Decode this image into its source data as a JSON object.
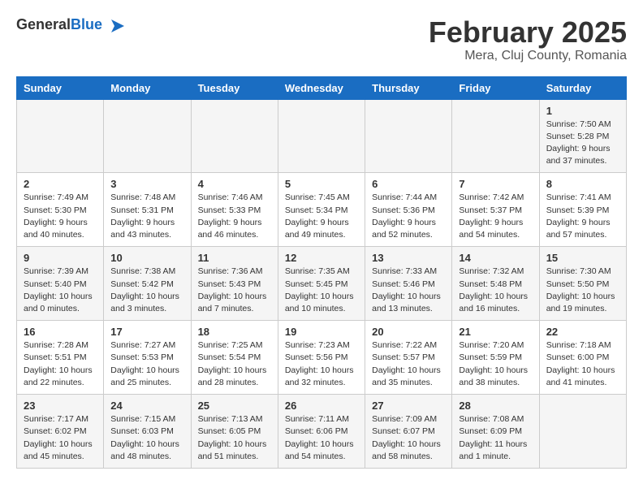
{
  "header": {
    "logo_general": "General",
    "logo_blue": "Blue",
    "month_title": "February 2025",
    "location": "Mera, Cluj County, Romania"
  },
  "weekdays": [
    "Sunday",
    "Monday",
    "Tuesday",
    "Wednesday",
    "Thursday",
    "Friday",
    "Saturday"
  ],
  "weeks": [
    [
      {
        "day": "",
        "info": ""
      },
      {
        "day": "",
        "info": ""
      },
      {
        "day": "",
        "info": ""
      },
      {
        "day": "",
        "info": ""
      },
      {
        "day": "",
        "info": ""
      },
      {
        "day": "",
        "info": ""
      },
      {
        "day": "1",
        "info": "Sunrise: 7:50 AM\nSunset: 5:28 PM\nDaylight: 9 hours and 37 minutes."
      }
    ],
    [
      {
        "day": "2",
        "info": "Sunrise: 7:49 AM\nSunset: 5:30 PM\nDaylight: 9 hours and 40 minutes."
      },
      {
        "day": "3",
        "info": "Sunrise: 7:48 AM\nSunset: 5:31 PM\nDaylight: 9 hours and 43 minutes."
      },
      {
        "day": "4",
        "info": "Sunrise: 7:46 AM\nSunset: 5:33 PM\nDaylight: 9 hours and 46 minutes."
      },
      {
        "day": "5",
        "info": "Sunrise: 7:45 AM\nSunset: 5:34 PM\nDaylight: 9 hours and 49 minutes."
      },
      {
        "day": "6",
        "info": "Sunrise: 7:44 AM\nSunset: 5:36 PM\nDaylight: 9 hours and 52 minutes."
      },
      {
        "day": "7",
        "info": "Sunrise: 7:42 AM\nSunset: 5:37 PM\nDaylight: 9 hours and 54 minutes."
      },
      {
        "day": "8",
        "info": "Sunrise: 7:41 AM\nSunset: 5:39 PM\nDaylight: 9 hours and 57 minutes."
      }
    ],
    [
      {
        "day": "9",
        "info": "Sunrise: 7:39 AM\nSunset: 5:40 PM\nDaylight: 10 hours and 0 minutes."
      },
      {
        "day": "10",
        "info": "Sunrise: 7:38 AM\nSunset: 5:42 PM\nDaylight: 10 hours and 3 minutes."
      },
      {
        "day": "11",
        "info": "Sunrise: 7:36 AM\nSunset: 5:43 PM\nDaylight: 10 hours and 7 minutes."
      },
      {
        "day": "12",
        "info": "Sunrise: 7:35 AM\nSunset: 5:45 PM\nDaylight: 10 hours and 10 minutes."
      },
      {
        "day": "13",
        "info": "Sunrise: 7:33 AM\nSunset: 5:46 PM\nDaylight: 10 hours and 13 minutes."
      },
      {
        "day": "14",
        "info": "Sunrise: 7:32 AM\nSunset: 5:48 PM\nDaylight: 10 hours and 16 minutes."
      },
      {
        "day": "15",
        "info": "Sunrise: 7:30 AM\nSunset: 5:50 PM\nDaylight: 10 hours and 19 minutes."
      }
    ],
    [
      {
        "day": "16",
        "info": "Sunrise: 7:28 AM\nSunset: 5:51 PM\nDaylight: 10 hours and 22 minutes."
      },
      {
        "day": "17",
        "info": "Sunrise: 7:27 AM\nSunset: 5:53 PM\nDaylight: 10 hours and 25 minutes."
      },
      {
        "day": "18",
        "info": "Sunrise: 7:25 AM\nSunset: 5:54 PM\nDaylight: 10 hours and 28 minutes."
      },
      {
        "day": "19",
        "info": "Sunrise: 7:23 AM\nSunset: 5:56 PM\nDaylight: 10 hours and 32 minutes."
      },
      {
        "day": "20",
        "info": "Sunrise: 7:22 AM\nSunset: 5:57 PM\nDaylight: 10 hours and 35 minutes."
      },
      {
        "day": "21",
        "info": "Sunrise: 7:20 AM\nSunset: 5:59 PM\nDaylight: 10 hours and 38 minutes."
      },
      {
        "day": "22",
        "info": "Sunrise: 7:18 AM\nSunset: 6:00 PM\nDaylight: 10 hours and 41 minutes."
      }
    ],
    [
      {
        "day": "23",
        "info": "Sunrise: 7:17 AM\nSunset: 6:02 PM\nDaylight: 10 hours and 45 minutes."
      },
      {
        "day": "24",
        "info": "Sunrise: 7:15 AM\nSunset: 6:03 PM\nDaylight: 10 hours and 48 minutes."
      },
      {
        "day": "25",
        "info": "Sunrise: 7:13 AM\nSunset: 6:05 PM\nDaylight: 10 hours and 51 minutes."
      },
      {
        "day": "26",
        "info": "Sunrise: 7:11 AM\nSunset: 6:06 PM\nDaylight: 10 hours and 54 minutes."
      },
      {
        "day": "27",
        "info": "Sunrise: 7:09 AM\nSunset: 6:07 PM\nDaylight: 10 hours and 58 minutes."
      },
      {
        "day": "28",
        "info": "Sunrise: 7:08 AM\nSunset: 6:09 PM\nDaylight: 11 hours and 1 minute."
      },
      {
        "day": "",
        "info": ""
      }
    ]
  ]
}
